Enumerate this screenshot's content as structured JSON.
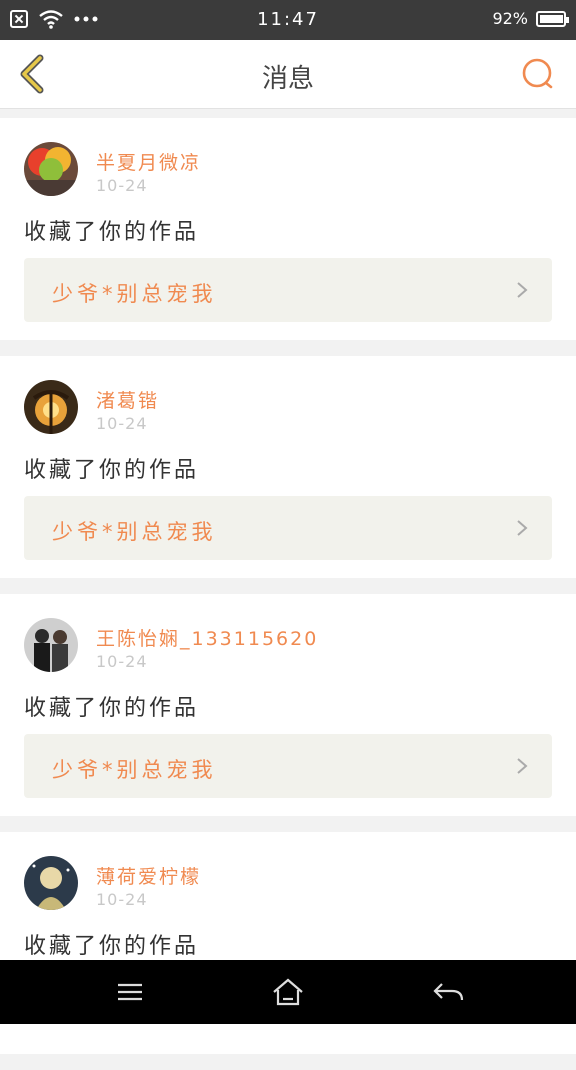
{
  "status_bar": {
    "time": "11:47",
    "battery_text": "92%",
    "battery_level": 0.92
  },
  "header": {
    "title": "消息"
  },
  "notifications": [
    {
      "username": "半夏月微凉",
      "date": "10-24",
      "action": "收藏了你的作品",
      "work_title": "少爷*别总宠我"
    },
    {
      "username": "渚葛锴",
      "date": "10-24",
      "action": "收藏了你的作品",
      "work_title": "少爷*别总宠我"
    },
    {
      "username": "王陈怡娴_133115620",
      "date": "10-24",
      "action": "收藏了你的作品",
      "work_title": "少爷*别总宠我"
    },
    {
      "username": "薄荷爱柠檬",
      "date": "10-24",
      "action": "收藏了你的作品"
    }
  ],
  "colors": {
    "accent": "#f08a50",
    "back_icon": "#e6c84a"
  }
}
